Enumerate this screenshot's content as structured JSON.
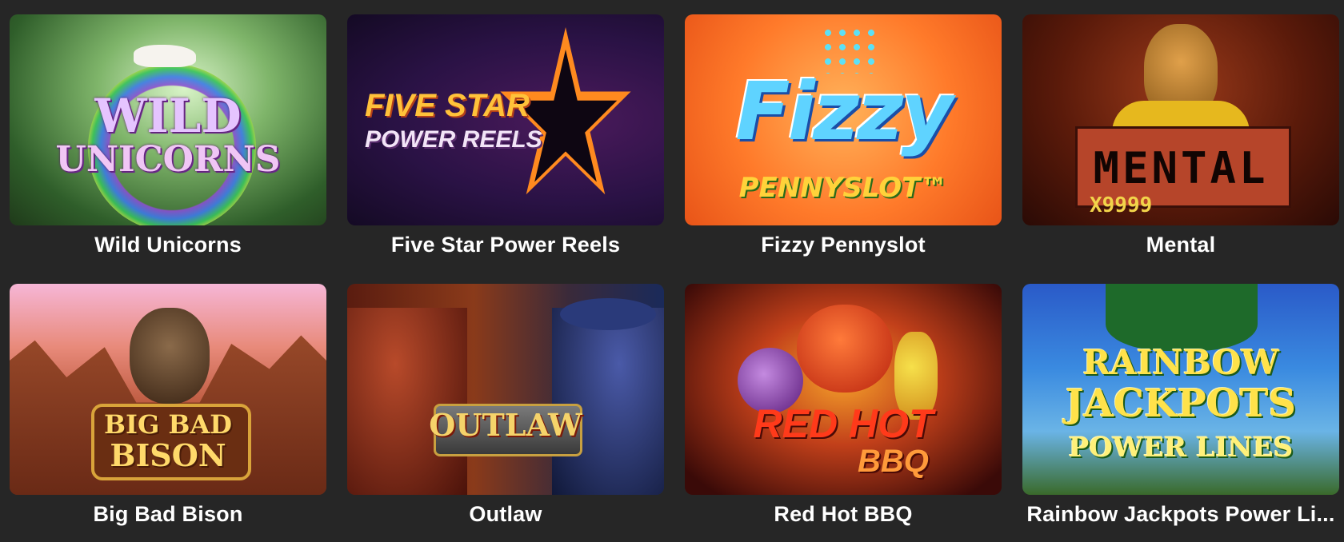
{
  "games": [
    {
      "title": "Wild Unicorns",
      "logo_lines": [
        "WILD",
        "UNICORNS"
      ],
      "accent": "#7fb56a"
    },
    {
      "title": "Five Star Power Reels",
      "logo_lines": [
        "FIVE STAR",
        "POWER REELS"
      ],
      "accent": "#ff8a1f"
    },
    {
      "title": "Fizzy Pennyslot",
      "logo_lines": [
        "Fizzy",
        "PENNYSLOT™"
      ],
      "accent": "#ff7a2a"
    },
    {
      "title": "Mental",
      "logo_lines": [
        "MENTAL",
        "X9999"
      ],
      "accent": "#9a3a1a"
    },
    {
      "title": "Big Bad Bison",
      "logo_lines": [
        "BIG BAD",
        "BISON"
      ],
      "accent": "#b9563a"
    },
    {
      "title": "Outlaw",
      "logo_lines": [
        "OUTLAW"
      ],
      "accent": "#8a3a1a"
    },
    {
      "title": "Red Hot BBQ",
      "logo_lines": [
        "RED HOT",
        "BBQ"
      ],
      "accent": "#c2401a"
    },
    {
      "title": "Rainbow Jackpots Power Li...",
      "logo_lines": [
        "RAINBOW",
        "JACKPOTS",
        "POWER LINES"
      ],
      "accent": "#3a8ae0"
    }
  ]
}
